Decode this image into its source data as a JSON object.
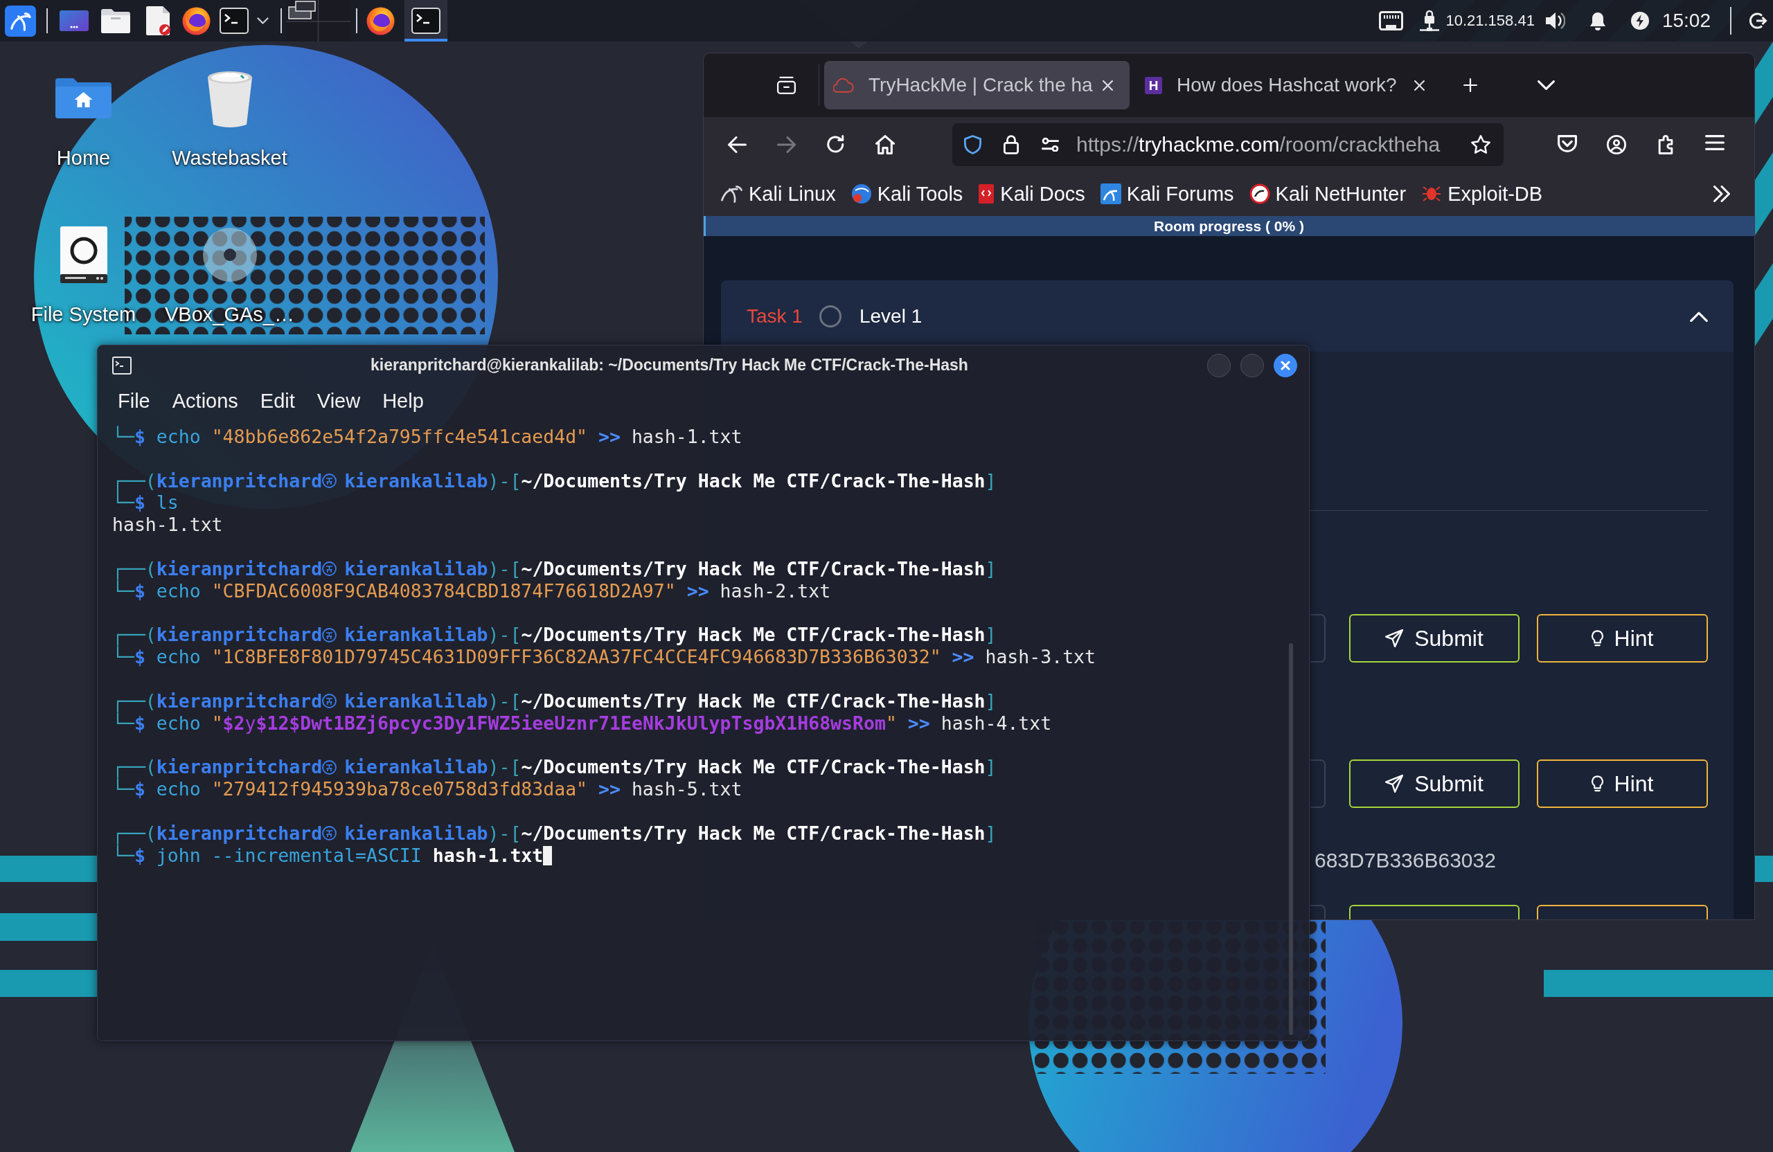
{
  "taskbar": {
    "tasks": [
      {
        "selected": false
      },
      {
        "selected": true
      }
    ],
    "ip_address": "10.21.158.41",
    "time": "15:02"
  },
  "desktop_icons": [
    {
      "label": "Home"
    },
    {
      "label": "Wastebasket"
    },
    {
      "label": "File System"
    },
    {
      "label": "VBox_GAs_…"
    }
  ],
  "browser": {
    "tabs": [
      {
        "title": "TryHackMe | Crack the ha",
        "selected": true
      },
      {
        "title": "How does Hashcat work?",
        "selected": false,
        "icon_letter": "H"
      }
    ],
    "navigation": {
      "back_enabled": true,
      "forward_enabled": false
    },
    "address": {
      "scheme": "https://",
      "host": "tryhackme.com",
      "path": "/room/cracktheha"
    },
    "bookmarks": [
      "Kali Linux",
      "Kali Tools",
      "Kali Docs",
      "Kali Forums",
      "Kali NetHunter",
      "Exploit-DB"
    ],
    "progress": {
      "label": "Room progress ( 0% )",
      "level": 0
    },
    "task": {
      "label": "Task 1",
      "title": "Level 1",
      "completed": false,
      "expanded": true
    },
    "questions": [
      {
        "kind": "full",
        "submit": "Submit",
        "hint": "Hint"
      },
      {
        "kind": "full",
        "submit": "Submit",
        "hint": "Hint"
      },
      {
        "kind": "cut",
        "hash": "683D7B336B63032"
      }
    ]
  },
  "terminal": {
    "title": "kieranpritchard@kierankalilab: ~/Documents/Try Hack Me CTF/Crack-The-Hash",
    "menu": [
      "File",
      "Actions",
      "Edit",
      "View",
      "Help"
    ],
    "lines": [
      {
        "kind": "command",
        "parts": [
          {
            "kind": "frame",
            "text": "└─"
          },
          {
            "kind": "sigil",
            "text": "$"
          },
          {
            "kind": "cmd",
            "text": " echo"
          },
          {
            "kind": "string",
            "text": " \"48bb6e862e54f2a795ffc4e541caed4d\""
          },
          {
            "kind": "operator",
            "text": " >>"
          },
          {
            "kind": "plain",
            "text": " hash-1.txt"
          }
        ]
      },
      {
        "kind": "prompt",
        "open": "┌──(",
        "user": "kieranpritchard",
        "host": "kierankalilab",
        "mid": ")-[",
        "path": "~/Documents/Try Hack Me CTF/Crack-The-Hash",
        "close": "]"
      },
      {
        "kind": "command",
        "parts": [
          {
            "kind": "frame",
            "text": "└─"
          },
          {
            "kind": "sigil",
            "text": "$"
          },
          {
            "kind": "cmd",
            "text": " ls"
          }
        ]
      },
      {
        "kind": "output",
        "text": "hash-1.txt"
      },
      {
        "kind": "prompt",
        "open": "┌──(",
        "user": "kieranpritchard",
        "host": "kierankalilab",
        "mid": ")-[",
        "path": "~/Documents/Try Hack Me CTF/Crack-The-Hash",
        "close": "]"
      },
      {
        "kind": "command",
        "parts": [
          {
            "kind": "frame",
            "text": "└─"
          },
          {
            "kind": "sigil",
            "text": "$"
          },
          {
            "kind": "cmd",
            "text": " echo"
          },
          {
            "kind": "string",
            "text": " \"CBFDAC6008F9CAB4083784CBD1874F76618D2A97\""
          },
          {
            "kind": "operator",
            "text": " >>"
          },
          {
            "kind": "plain",
            "text": " hash-2.txt"
          }
        ]
      },
      {
        "kind": "prompt",
        "open": "┌──(",
        "user": "kieranpritchard",
        "host": "kierankalilab",
        "mid": ")-[",
        "path": "~/Documents/Try Hack Me CTF/Crack-The-Hash",
        "close": "]"
      },
      {
        "kind": "command",
        "parts": [
          {
            "kind": "frame",
            "text": "└─"
          },
          {
            "kind": "sigil",
            "text": "$"
          },
          {
            "kind": "cmd",
            "text": " echo"
          },
          {
            "kind": "string",
            "text": " \"1C8BFE8F801D79745C4631D09FFF36C82AA37FC4CCE4FC946683D7B336B63032\""
          },
          {
            "kind": "operator",
            "text": " >>"
          },
          {
            "kind": "plain",
            "text": " hash-3.txt"
          }
        ]
      },
      {
        "kind": "prompt",
        "open": "┌──(",
        "user": "kieranpritchard",
        "host": "kierankalilab",
        "mid": ")-[",
        "path": "~/Documents/Try Hack Me CTF/Crack-The-Hash",
        "close": "]"
      },
      {
        "kind": "command",
        "parts": [
          {
            "kind": "frame",
            "text": "└─"
          },
          {
            "kind": "sigil",
            "text": "$"
          },
          {
            "kind": "cmd",
            "text": " echo"
          },
          {
            "kind": "string",
            "text": " \""
          },
          {
            "kind": "variable",
            "text": "$2"
          },
          {
            "kind": "varplain",
            "text": "y"
          },
          {
            "kind": "variable",
            "text": "$12$Dwt1BZj6pcyc3Dy1FWZ5ieeUznr71EeNkJkUlypTsgbX1H68wsRom"
          },
          {
            "kind": "string",
            "text": "\""
          },
          {
            "kind": "operator",
            "text": " >>"
          },
          {
            "kind": "plain",
            "text": " hash-4.txt"
          }
        ]
      },
      {
        "kind": "prompt",
        "open": "┌──(",
        "user": "kieranpritchard",
        "host": "kierankalilab",
        "mid": ")-[",
        "path": "~/Documents/Try Hack Me CTF/Crack-The-Hash",
        "close": "]"
      },
      {
        "kind": "command",
        "parts": [
          {
            "kind": "frame",
            "text": "└─"
          },
          {
            "kind": "sigil",
            "text": "$"
          },
          {
            "kind": "cmd",
            "text": " echo"
          },
          {
            "kind": "string",
            "text": " \"279412f945939ba78ce0758d3fd83daa\""
          },
          {
            "kind": "operator",
            "text": " >>"
          },
          {
            "kind": "plain",
            "text": " hash-5.txt"
          }
        ]
      },
      {
        "kind": "prompt",
        "open": "┌──(",
        "user": "kieranpritchard",
        "host": "kierankalilab",
        "mid": ")-[",
        "path": "~/Documents/Try Hack Me CTF/Crack-The-Hash",
        "close": "]"
      },
      {
        "kind": "command",
        "cursor": true,
        "parts": [
          {
            "kind": "frame",
            "text": "└─"
          },
          {
            "kind": "sigil",
            "text": "$"
          },
          {
            "kind": "cmd",
            "text": " john --incremental=ASCII"
          },
          {
            "kind": "bold",
            "text": " hash-1.txt"
          }
        ]
      }
    ]
  }
}
